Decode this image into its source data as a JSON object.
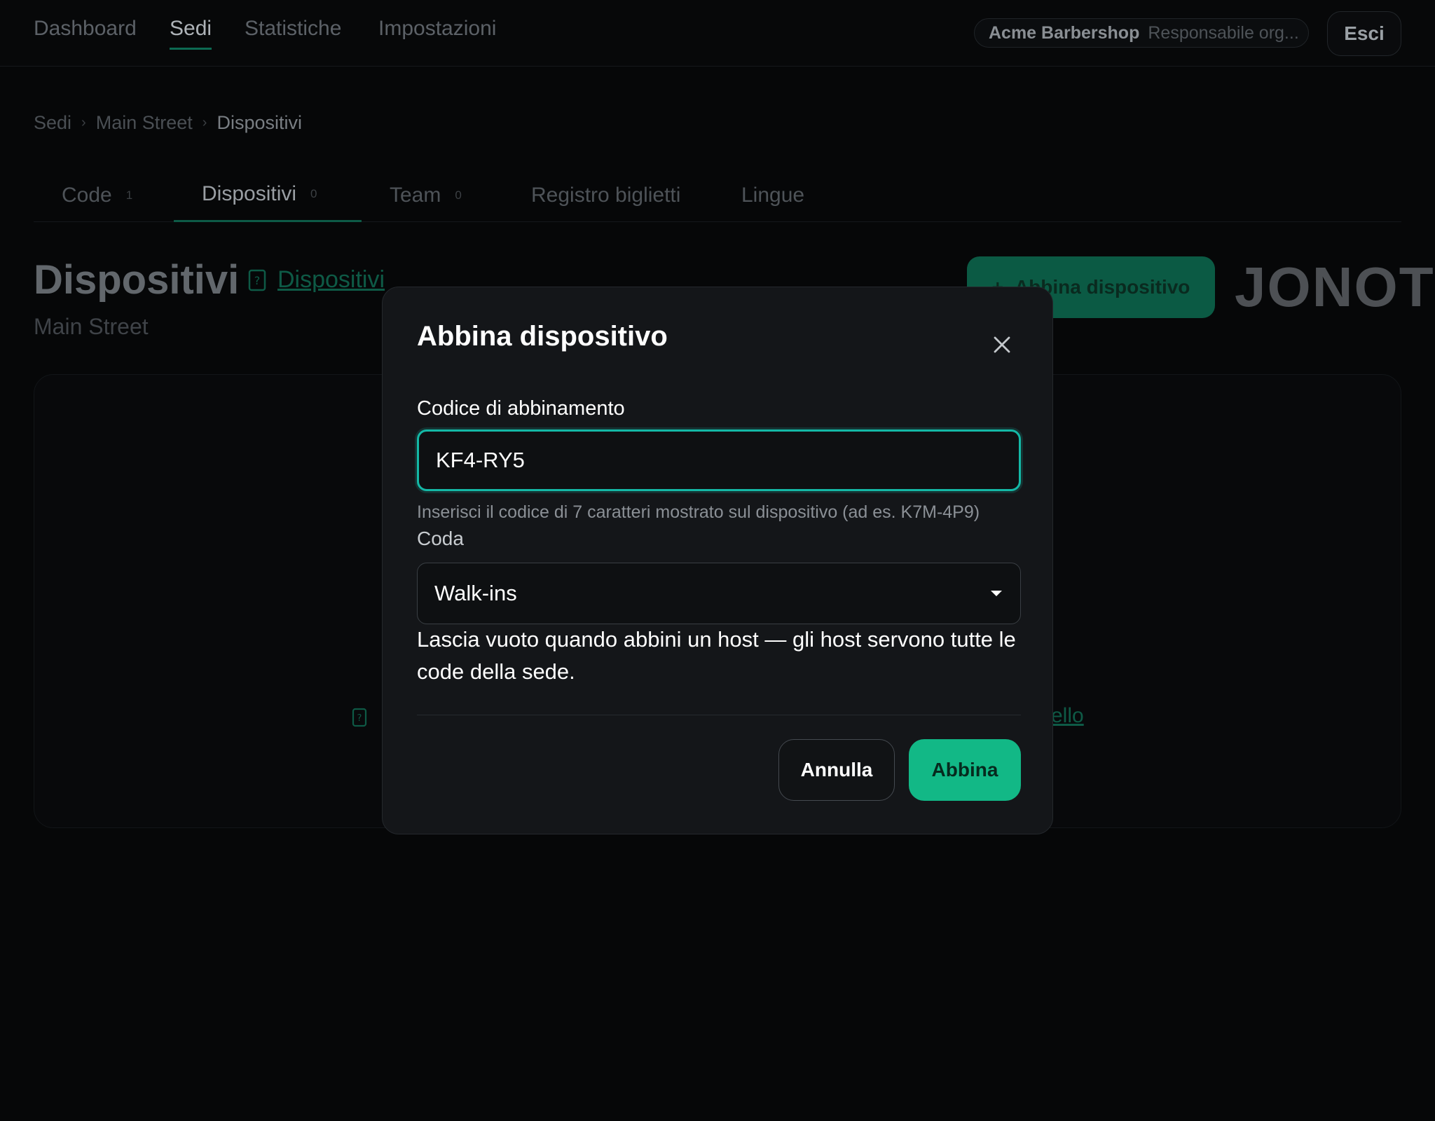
{
  "topnav": {
    "links": [
      "Dashboard",
      "Sedi",
      "Statistiche",
      "Impostazioni"
    ],
    "org_name": "Acme Barbershop",
    "org_role": "Responsabile org...",
    "logout_label": "Esci"
  },
  "breadcrumb": [
    "Sedi",
    "Main Street",
    "Dispositivi"
  ],
  "tabs": [
    {
      "label": "Code",
      "count": "1"
    },
    {
      "label": "Dispositivi",
      "count": "0"
    },
    {
      "label": "Team",
      "count": "0"
    },
    {
      "label": "Registro biglietti"
    },
    {
      "label": "Lingue"
    }
  ],
  "header": {
    "title": "Dispositivi",
    "doc_link": "Dispositivi",
    "subtitle": "Main Street",
    "primary_button": "Abbina dispositivo",
    "brand": "JONOT"
  },
  "card": {
    "link_fragment": "ello"
  },
  "modal": {
    "title": "Abbina dispositivo",
    "code_label": "Codice di abbinamento",
    "code_value": "KF4-RY5",
    "code_hint": "Inserisci il codice di 7 caratteri mostrato sul dispositivo (ad es. K7M-4P9)",
    "queue_label": "Coda",
    "queue_value": "Walk-ins",
    "queue_help": "Lascia vuoto quando abbini un host — gli host servono tutte le code della sede.",
    "cancel_label": "Annulla",
    "confirm_label": "Abbina"
  },
  "colors": {
    "accent": "#12b886",
    "focus_ring": "#14b8a6",
    "modal_bg": "#141619",
    "page_bg": "#060708"
  }
}
